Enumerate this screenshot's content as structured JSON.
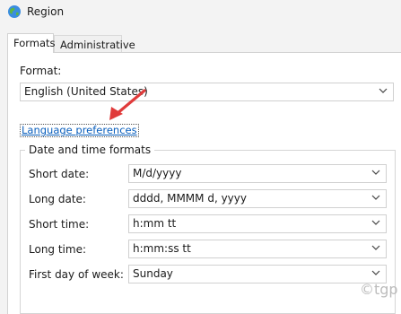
{
  "window": {
    "title": "Region",
    "icon": "globe-icon"
  },
  "tabs": [
    {
      "label": "Formats",
      "active": true
    },
    {
      "label": "Administrative",
      "active": false
    }
  ],
  "format": {
    "label": "Format:",
    "value": "English (United States)"
  },
  "language_link": "Language preferences",
  "datetime": {
    "group_title": "Date and time formats",
    "rows": [
      {
        "label": "Short date:",
        "value": "M/d/yyyy"
      },
      {
        "label": "Long date:",
        "value": "dddd, MMMM d, yyyy"
      },
      {
        "label": "Short time:",
        "value": "h:mm tt"
      },
      {
        "label": "Long time:",
        "value": "h:mm:ss tt"
      },
      {
        "label": "First day of week:",
        "value": "Sunday"
      }
    ]
  },
  "annotation": {
    "arrow_color": "#e03b3b",
    "arrow_target": "Language preferences"
  },
  "watermark": "©tgp",
  "colors": {
    "link": "#0a5fbd",
    "window_bg": "#f3f3f3",
    "panel_bg": "#ffffff"
  }
}
